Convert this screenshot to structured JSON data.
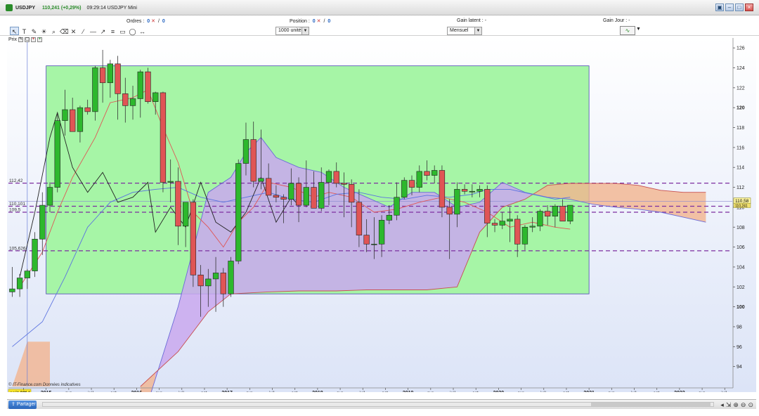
{
  "window": {
    "symbol": "USDJPY",
    "price": "110,241 (+0,29%)",
    "time_title": "09:29:14 USDJPY Mini",
    "icons": [
      "restore-icon",
      "minimize-icon",
      "maximize-icon",
      "close-icon"
    ]
  },
  "info": {
    "orders_label": "Ordres :",
    "orders_value": "0",
    "orders_value2": "0",
    "position_label": "Position :",
    "position_value": "0",
    "position_value2": "0",
    "gain_latent_label": "Gain latent : -",
    "gain_jour_label": "Gain Jour : -"
  },
  "toolbar": {
    "quantity": "1000 unités",
    "period": "Mensuel"
  },
  "chart_subbar": {
    "label": "Prix"
  },
  "source_note": "© IT-Finance.com  Données indicatives",
  "bottom": {
    "share_label": "Partager"
  },
  "colors": {
    "bull": "#2db82d",
    "bear": "#e05555",
    "rect_fill": "#a6f5a6",
    "cloud_purple": "#c9a8ef",
    "cloud_orange": "#f2b48e",
    "tenkan": "#e05555",
    "kijun": "#5b73e0",
    "chikou": "#222222",
    "hline": "#7d2fa0"
  },
  "chart_data": {
    "type": "candlestick",
    "ylim": [
      92,
      127
    ],
    "y_ticks": [
      94,
      96,
      98,
      100,
      102,
      104,
      106,
      108,
      110,
      112,
      114,
      116,
      118,
      120,
      122,
      124,
      126
    ],
    "x_axis": {
      "start": "2014-08",
      "end": "2022-07",
      "highlight_label": "août 2014",
      "labels": [
        {
          "t": "2014-10",
          "label": "oct."
        },
        {
          "t": "2015-01",
          "label": "2015"
        },
        {
          "t": "2015-04",
          "label": "avr."
        },
        {
          "t": "2015-07",
          "label": "juil."
        },
        {
          "t": "2015-10",
          "label": "oct."
        },
        {
          "t": "2016-01",
          "label": "2016"
        },
        {
          "t": "2016-04",
          "label": "avr."
        },
        {
          "t": "2016-07",
          "label": "juil."
        },
        {
          "t": "2016-10",
          "label": "oct."
        },
        {
          "t": "2017-01",
          "label": "2017"
        },
        {
          "t": "2017-04",
          "label": "avr."
        },
        {
          "t": "2017-07",
          "label": "juil."
        },
        {
          "t": "2017-10",
          "label": "oct."
        },
        {
          "t": "2018-01",
          "label": "2018"
        },
        {
          "t": "2018-04",
          "label": "avr."
        },
        {
          "t": "2018-07",
          "label": "juil."
        },
        {
          "t": "2018-10",
          "label": "oct."
        },
        {
          "t": "2019-01",
          "label": "2019"
        },
        {
          "t": "2019-04",
          "label": "avr."
        },
        {
          "t": "2019-07",
          "label": "juil."
        },
        {
          "t": "2019-10",
          "label": "oct."
        },
        {
          "t": "2020-01",
          "label": "2020"
        },
        {
          "t": "2020-04",
          "label": "avr."
        },
        {
          "t": "2020-07",
          "label": "juil."
        },
        {
          "t": "2020-10",
          "label": "oct."
        },
        {
          "t": "2021-01",
          "label": "2021"
        },
        {
          "t": "2021-04",
          "label": "avr."
        },
        {
          "t": "2021-07",
          "label": "juil."
        },
        {
          "t": "2021-10",
          "label": "oct."
        },
        {
          "t": "2022-01",
          "label": "2022"
        },
        {
          "t": "2022-04",
          "label": "avr."
        },
        {
          "t": "2022-07",
          "label": "juil."
        }
      ]
    },
    "candles": [
      {
        "t": "2014-08",
        "o": 101.5,
        "h": 104.0,
        "l": 101.0,
        "c": 101.8
      },
      {
        "t": "2014-09",
        "o": 101.8,
        "h": 103.3,
        "l": 101.0,
        "c": 102.9
      },
      {
        "t": "2014-10",
        "o": 102.9,
        "h": 103.8,
        "l": 101.8,
        "c": 103.6
      },
      {
        "t": "2014-11",
        "o": 103.6,
        "h": 107.5,
        "l": 103.0,
        "c": 106.8
      },
      {
        "t": "2014-12",
        "o": 106.8,
        "h": 111.5,
        "l": 105.2,
        "c": 110.2
      },
      {
        "t": "2015-01",
        "o": 110.2,
        "h": 112.5,
        "l": 109.5,
        "c": 112.0
      },
      {
        "t": "2015-02",
        "o": 112.0,
        "h": 119.5,
        "l": 111.5,
        "c": 118.7
      },
      {
        "t": "2015-03",
        "o": 118.7,
        "h": 121.8,
        "l": 117.2,
        "c": 119.8
      },
      {
        "t": "2015-04",
        "o": 119.8,
        "h": 121.0,
        "l": 118.0,
        "c": 117.6
      },
      {
        "t": "2015-05",
        "o": 117.6,
        "h": 120.2,
        "l": 116.5,
        "c": 120.0
      },
      {
        "t": "2015-06",
        "o": 120.0,
        "h": 120.8,
        "l": 119.3,
        "c": 119.6
      },
      {
        "t": "2015-07",
        "o": 119.6,
        "h": 124.2,
        "l": 118.7,
        "c": 124.0
      },
      {
        "t": "2015-08",
        "o": 124.0,
        "h": 125.8,
        "l": 120.5,
        "c": 122.5
      },
      {
        "t": "2015-09",
        "o": 122.5,
        "h": 124.8,
        "l": 121.0,
        "c": 124.4
      },
      {
        "t": "2015-10",
        "o": 124.4,
        "h": 125.2,
        "l": 118.8,
        "c": 121.4
      },
      {
        "t": "2015-11",
        "o": 121.4,
        "h": 123.0,
        "l": 118.5,
        "c": 120.2
      },
      {
        "t": "2015-12",
        "o": 120.2,
        "h": 122.2,
        "l": 118.8,
        "c": 120.9
      },
      {
        "t": "2016-01",
        "o": 120.9,
        "h": 123.8,
        "l": 119.0,
        "c": 123.6
      },
      {
        "t": "2016-02",
        "o": 123.6,
        "h": 124.0,
        "l": 120.4,
        "c": 120.6
      },
      {
        "t": "2016-03",
        "o": 120.6,
        "h": 121.6,
        "l": 119.3,
        "c": 121.5
      },
      {
        "t": "2016-04",
        "o": 121.5,
        "h": 121.6,
        "l": 111.5,
        "c": 112.5
      },
      {
        "t": "2016-05",
        "o": 112.5,
        "h": 114.8,
        "l": 110.5,
        "c": 112.6
      },
      {
        "t": "2016-06",
        "o": 112.6,
        "h": 114.0,
        "l": 106.2,
        "c": 108.1
      },
      {
        "t": "2016-07",
        "o": 108.1,
        "h": 110.2,
        "l": 106.0,
        "c": 110.5
      },
      {
        "t": "2016-08",
        "o": 110.5,
        "h": 110.8,
        "l": 102.0,
        "c": 103.2
      },
      {
        "t": "2016-09",
        "o": 103.2,
        "h": 104.2,
        "l": 99.0,
        "c": 102.1
      },
      {
        "t": "2016-10",
        "o": 102.1,
        "h": 103.8,
        "l": 100.0,
        "c": 102.8
      },
      {
        "t": "2016-11",
        "o": 102.8,
        "h": 105.0,
        "l": 99.5,
        "c": 103.4
      },
      {
        "t": "2016-12",
        "o": 103.4,
        "h": 103.9,
        "l": 100.0,
        "c": 101.3
      },
      {
        "t": "2017-01",
        "o": 101.3,
        "h": 105.0,
        "l": 101.0,
        "c": 104.6
      },
      {
        "t": "2017-02",
        "o": 104.6,
        "h": 114.8,
        "l": 104.3,
        "c": 114.4
      },
      {
        "t": "2017-03",
        "o": 114.4,
        "h": 118.5,
        "l": 113.2,
        "c": 116.8
      },
      {
        "t": "2017-04",
        "o": 116.8,
        "h": 118.6,
        "l": 112.0,
        "c": 112.6
      },
      {
        "t": "2017-05",
        "o": 112.6,
        "h": 117.8,
        "l": 111.8,
        "c": 112.9
      },
      {
        "t": "2017-06",
        "o": 112.9,
        "h": 114.4,
        "l": 111.2,
        "c": 111.2
      },
      {
        "t": "2017-07",
        "o": 111.2,
        "h": 112.2,
        "l": 110.5,
        "c": 111.0
      },
      {
        "t": "2017-08",
        "o": 111.0,
        "h": 111.3,
        "l": 108.4,
        "c": 110.8
      },
      {
        "t": "2017-09",
        "o": 110.8,
        "h": 113.9,
        "l": 110.2,
        "c": 112.4
      },
      {
        "t": "2017-10",
        "o": 112.4,
        "h": 113.0,
        "l": 108.5,
        "c": 110.2
      },
      {
        "t": "2017-11",
        "o": 110.2,
        "h": 114.7,
        "l": 110.0,
        "c": 112.0
      },
      {
        "t": "2017-12",
        "o": 112.0,
        "h": 113.6,
        "l": 110.8,
        "c": 109.9
      },
      {
        "t": "2018-01",
        "o": 109.9,
        "h": 114.0,
        "l": 109.6,
        "c": 112.5
      },
      {
        "t": "2018-02",
        "o": 112.5,
        "h": 113.8,
        "l": 110.2,
        "c": 113.6
      },
      {
        "t": "2018-03",
        "o": 113.6,
        "h": 114.5,
        "l": 112.0,
        "c": 112.4
      },
      {
        "t": "2018-04",
        "o": 112.4,
        "h": 113.5,
        "l": 109.0,
        "c": 112.3
      },
      {
        "t": "2018-05",
        "o": 112.3,
        "h": 112.8,
        "l": 108.0,
        "c": 110.5
      },
      {
        "t": "2018-06",
        "o": 110.5,
        "h": 111.8,
        "l": 106.0,
        "c": 107.2
      },
      {
        "t": "2018-07",
        "o": 107.2,
        "h": 108.8,
        "l": 105.5,
        "c": 106.3
      },
      {
        "t": "2018-08",
        "o": 106.3,
        "h": 109.0,
        "l": 104.8,
        "c": 106.3
      },
      {
        "t": "2018-09",
        "o": 106.3,
        "h": 109.2,
        "l": 105.0,
        "c": 108.7
      },
      {
        "t": "2018-10",
        "o": 108.7,
        "h": 110.2,
        "l": 108.3,
        "c": 109.2
      },
      {
        "t": "2018-11",
        "o": 109.2,
        "h": 112.5,
        "l": 108.7,
        "c": 111.0
      },
      {
        "t": "2018-12",
        "o": 111.0,
        "h": 113.0,
        "l": 110.8,
        "c": 112.7
      },
      {
        "t": "2019-01",
        "o": 112.7,
        "h": 113.2,
        "l": 111.2,
        "c": 112.0
      },
      {
        "t": "2019-02",
        "o": 112.0,
        "h": 114.2,
        "l": 111.5,
        "c": 113.6
      },
      {
        "t": "2019-03",
        "o": 113.6,
        "h": 114.7,
        "l": 112.7,
        "c": 113.2
      },
      {
        "t": "2019-04",
        "o": 113.2,
        "h": 114.2,
        "l": 112.4,
        "c": 113.7
      },
      {
        "t": "2019-05",
        "o": 113.7,
        "h": 114.2,
        "l": 109.0,
        "c": 110.0
      },
      {
        "t": "2019-06",
        "o": 110.0,
        "h": 110.8,
        "l": 104.8,
        "c": 109.3
      },
      {
        "t": "2019-07",
        "o": 109.3,
        "h": 112.5,
        "l": 108.0,
        "c": 111.8
      },
      {
        "t": "2019-08",
        "o": 111.8,
        "h": 112.3,
        "l": 111.3,
        "c": 111.6
      },
      {
        "t": "2019-09",
        "o": 111.6,
        "h": 112.3,
        "l": 111.0,
        "c": 111.6
      },
      {
        "t": "2019-10",
        "o": 111.6,
        "h": 112.2,
        "l": 111.0,
        "c": 111.8
      },
      {
        "t": "2019-11",
        "o": 111.8,
        "h": 112.2,
        "l": 107.0,
        "c": 108.4
      },
      {
        "t": "2019-12",
        "o": 108.4,
        "h": 108.8,
        "l": 107.5,
        "c": 108.2
      },
      {
        "t": "2020-01",
        "o": 108.2,
        "h": 109.5,
        "l": 107.8,
        "c": 108.6
      },
      {
        "t": "2020-02",
        "o": 108.6,
        "h": 110.0,
        "l": 106.5,
        "c": 108.8
      },
      {
        "t": "2020-03",
        "o": 108.8,
        "h": 109.2,
        "l": 105.0,
        "c": 106.3
      },
      {
        "t": "2020-04",
        "o": 106.3,
        "h": 108.2,
        "l": 105.7,
        "c": 108.0
      },
      {
        "t": "2020-05",
        "o": 108.0,
        "h": 109.0,
        "l": 107.5,
        "c": 108.1
      },
      {
        "t": "2020-06",
        "o": 108.1,
        "h": 109.8,
        "l": 107.6,
        "c": 109.6
      },
      {
        "t": "2020-07",
        "o": 109.6,
        "h": 110.2,
        "l": 108.2,
        "c": 109.1
      },
      {
        "t": "2020-08",
        "o": 109.1,
        "h": 110.3,
        "l": 108.0,
        "c": 110.1
      },
      {
        "t": "2020-09",
        "o": 110.1,
        "h": 110.8,
        "l": 108.8,
        "c": 108.6
      },
      {
        "t": "2020-10",
        "o": 108.6,
        "h": 110.2,
        "l": 108.3,
        "c": 110.2
      }
    ],
    "tenkan": [
      [
        "2014-09",
        102.0
      ],
      [
        "2014-12",
        105.5
      ],
      [
        "2015-02",
        109.5
      ],
      [
        "2015-04",
        113.0
      ],
      [
        "2015-07",
        117.0
      ],
      [
        "2015-09",
        120.5
      ],
      [
        "2015-12",
        121.0
      ],
      [
        "2016-02",
        121.8
      ],
      [
        "2016-04",
        118.0
      ],
      [
        "2016-06",
        114.5
      ],
      [
        "2016-08",
        109.5
      ],
      [
        "2016-10",
        108.0
      ],
      [
        "2016-12",
        106.0
      ],
      [
        "2017-02",
        108.5
      ],
      [
        "2017-04",
        110.0
      ],
      [
        "2017-06",
        112.5
      ],
      [
        "2017-09",
        112.0
      ],
      [
        "2017-12",
        111.0
      ],
      [
        "2018-02",
        111.5
      ],
      [
        "2018-05",
        111.0
      ],
      [
        "2018-08",
        109.5
      ],
      [
        "2018-11",
        109.8
      ],
      [
        "2019-02",
        110.5
      ],
      [
        "2019-05",
        111.0
      ],
      [
        "2019-08",
        110.5
      ],
      [
        "2019-11",
        109.5
      ],
      [
        "2020-02",
        108.0
      ],
      [
        "2020-05",
        108.5
      ],
      [
        "2020-08",
        108.0
      ],
      [
        "2020-10",
        107.8
      ]
    ],
    "kijun": [
      [
        "2014-08",
        96.0
      ],
      [
        "2014-12",
        98.5
      ],
      [
        "2015-03",
        103.0
      ],
      [
        "2015-06",
        108.0
      ],
      [
        "2015-09",
        110.5
      ],
      [
        "2015-12",
        111.5
      ],
      [
        "2016-03",
        111.8
      ],
      [
        "2016-06",
        112.0
      ],
      [
        "2016-09",
        111.0
      ],
      [
        "2016-12",
        110.5
      ],
      [
        "2017-03",
        111.0
      ],
      [
        "2017-06",
        111.5
      ],
      [
        "2017-09",
        110.8
      ],
      [
        "2017-12",
        110.5
      ],
      [
        "2018-03",
        111.3
      ],
      [
        "2018-06",
        111.5
      ],
      [
        "2018-09",
        111.0
      ],
      [
        "2018-12",
        110.8
      ],
      [
        "2019-03",
        111.2
      ],
      [
        "2019-06",
        111.0
      ],
      [
        "2019-09",
        111.3
      ],
      [
        "2019-11",
        111.8
      ],
      [
        "2020-02",
        111.8
      ],
      [
        "2020-05",
        111.3
      ],
      [
        "2020-08",
        110.8
      ],
      [
        "2020-10",
        111.0
      ]
    ],
    "chikou": [
      [
        "2014-09",
        103.0
      ],
      [
        "2014-11",
        109.5
      ],
      [
        "2015-01",
        117.0
      ],
      [
        "2015-02",
        119.5
      ],
      [
        "2015-04",
        114.0
      ],
      [
        "2015-06",
        111.5
      ],
      [
        "2015-08",
        113.5
      ],
      [
        "2015-10",
        110.5
      ],
      [
        "2015-12",
        111.0
      ],
      [
        "2016-02",
        112.5
      ],
      [
        "2016-03",
        107.5
      ],
      [
        "2016-05",
        110.0
      ],
      [
        "2016-07",
        108.0
      ],
      [
        "2016-09",
        112.5
      ],
      [
        "2016-11",
        108.5
      ],
      [
        "2017-01",
        107.5
      ],
      [
        "2017-03",
        109.5
      ],
      [
        "2017-05",
        113.0
      ],
      [
        "2017-07",
        108.5
      ],
      [
        "2017-09",
        111.0
      ],
      [
        "2017-10",
        110.2
      ]
    ],
    "cloud_green": [
      [
        "2016-01",
        88.0
      ],
      [
        "2016-06",
        100.0
      ],
      [
        "2016-10",
        111.5
      ],
      [
        "2017-01",
        113.0
      ],
      [
        "2017-03",
        115.5
      ],
      [
        "2017-05",
        117.0
      ],
      [
        "2017-07",
        115.0
      ],
      [
        "2017-10",
        114.0
      ],
      [
        "2018-01",
        113.5
      ],
      [
        "2018-04",
        112.0
      ],
      [
        "2018-07",
        111.0
      ],
      [
        "2018-10",
        110.0
      ],
      [
        "2019-01",
        111.5
      ],
      [
        "2019-04",
        111.5
      ],
      [
        "2019-07",
        110.0
      ],
      [
        "2019-10",
        110.5
      ],
      [
        "2020-01",
        112.5
      ],
      [
        "2020-04",
        111.5
      ],
      [
        "2020-07",
        111.0
      ],
      [
        "2020-10",
        110.8
      ],
      [
        "2021-01",
        110.3
      ],
      [
        "2021-04",
        110.0
      ],
      [
        "2021-07",
        109.8
      ],
      [
        "2021-10",
        109.5
      ],
      [
        "2022-01",
        109.0
      ],
      [
        "2022-04",
        108.5
      ]
    ],
    "cloud_red": [
      [
        "2016-01",
        92.0
      ],
      [
        "2016-06",
        95.5
      ],
      [
        "2016-10",
        99.5
      ],
      [
        "2017-01",
        101.3
      ],
      [
        "2017-06",
        101.5
      ],
      [
        "2017-10",
        101.6
      ],
      [
        "2018-03",
        101.6
      ],
      [
        "2018-07",
        101.7
      ],
      [
        "2018-11",
        101.7
      ],
      [
        "2019-03",
        101.7
      ],
      [
        "2019-07",
        102.0
      ],
      [
        "2019-10",
        107.5
      ],
      [
        "2020-01",
        110.0
      ],
      [
        "2020-04",
        110.8
      ],
      [
        "2020-07",
        112.2
      ],
      [
        "2020-10",
        112.4
      ],
      [
        "2021-01",
        112.4
      ],
      [
        "2021-04",
        112.4
      ],
      [
        "2021-07",
        112.2
      ],
      [
        "2021-10",
        111.7
      ],
      [
        "2022-01",
        111.5
      ],
      [
        "2022-04",
        111.5
      ]
    ],
    "cloud_left_orange": [
      [
        "2014-08",
        92.0
      ],
      [
        "2014-10",
        96.5
      ],
      [
        "2015-01",
        96.5
      ]
    ],
    "green_rect": {
      "t0": "2015-01",
      "t1": "2021-01",
      "y0": 101.3,
      "y1": 124.2
    },
    "hlines": [
      {
        "y": 112.42,
        "label": "112,42"
      },
      {
        "y": 110.101,
        "label": "110,101"
      },
      {
        "y": 109.5,
        "label": "109,5"
      },
      {
        "y": 105.626,
        "label": "105,626"
      }
    ],
    "current_price": {
      "y": 110.58,
      "label": "110,58"
    },
    "last_close_tag": {
      "y": 110.241,
      "label": "110,241"
    },
    "cursor_date": "2014-10"
  }
}
